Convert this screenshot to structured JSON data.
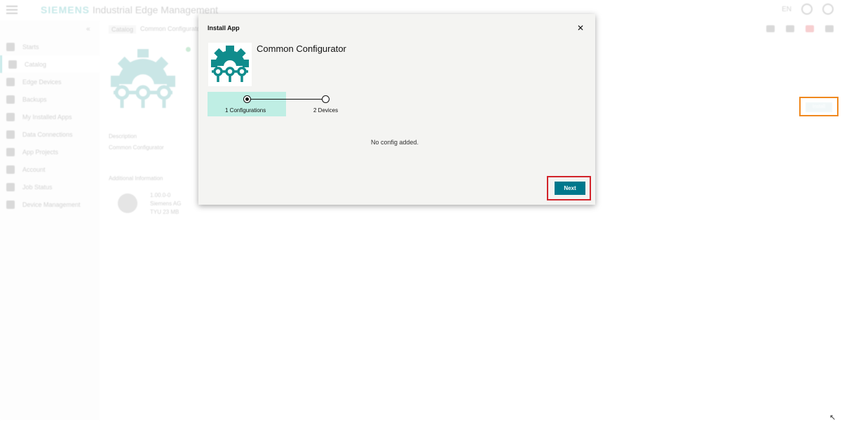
{
  "header": {
    "brand": "SIEMENS",
    "app_title": "Industrial Edge Management",
    "lang": "EN"
  },
  "breadcrumb": {
    "items": [
      "Catalog",
      "Common Configurator"
    ]
  },
  "sidebar": {
    "collapse_glyph": "«",
    "items": [
      {
        "label": "Starts",
        "icon": "home-icon"
      },
      {
        "label": "Catalog",
        "icon": "catalog-icon"
      },
      {
        "label": "Edge Devices",
        "icon": "devices-icon"
      },
      {
        "label": "Backups",
        "icon": "backup-icon"
      },
      {
        "label": "My Installed Apps",
        "icon": "apps-icon"
      },
      {
        "label": "Data Connections",
        "icon": "connections-icon"
      },
      {
        "label": "App Projects",
        "icon": "projects-icon"
      },
      {
        "label": "Account",
        "icon": "account-icon"
      },
      {
        "label": "Job Status",
        "icon": "jobs-icon"
      },
      {
        "label": "Device Management",
        "icon": "management-icon"
      }
    ]
  },
  "background": {
    "install_label": "Install",
    "description_heading": "Description",
    "description_text": "Common Configurator",
    "additional_heading": "Additional Information",
    "info_lines": [
      "1.00.0-0",
      "Siemens AG",
      "TYU 23 MB"
    ]
  },
  "modal": {
    "title": "Install App",
    "close_glyph": "✕",
    "app_name": "Common Configurator",
    "steps": [
      {
        "label": "1 Configurations",
        "active": true
      },
      {
        "label": "2 Devices",
        "active": false
      }
    ],
    "empty_message": "No config added.",
    "next_label": "Next",
    "colors": {
      "gear": "#0f8c8c",
      "primary": "#00788c",
      "active_step": "#bfeee4",
      "highlight": "#d2232a",
      "secondary_highlight": "#f0891e"
    }
  }
}
